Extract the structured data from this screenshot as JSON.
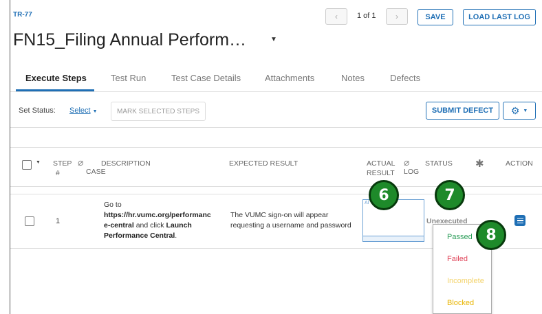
{
  "header": {
    "test_id": "TR-77",
    "title": "FN15_Filing Annual Perform…",
    "pager": {
      "prev": "‹",
      "text": "1 of 1",
      "next": "›"
    },
    "save_label": "SAVE",
    "load_last_log_label": "LOAD LAST LOG"
  },
  "tabs": [
    {
      "label": "Execute Steps"
    },
    {
      "label": "Test Run"
    },
    {
      "label": "Test Case Details"
    },
    {
      "label": "Attachments"
    },
    {
      "label": "Notes"
    },
    {
      "label": "Defects"
    }
  ],
  "status_bar": {
    "set_status_label": "Set Status:",
    "select_label": "Select",
    "mark_selected_label": "MARK SELECTED STEPS",
    "submit_defect_label": "SUBMIT DEFECT"
  },
  "table": {
    "headers": {
      "step": "STEP",
      "step_hash": "#",
      "case": "CASE",
      "description": "DESCRIPTION",
      "expected": "EXPECTED RESULT",
      "actual": "ACTUAL",
      "result": "RESULT",
      "log": "LOG",
      "status": "STATUS",
      "action": "ACTION"
    },
    "rows": [
      {
        "step": "1",
        "desc_line1": "Go to",
        "desc_url1": "https://hr.vumc.org/performanc",
        "desc_url2": "e-central",
        "desc_mid": " and click ",
        "desc_bold": "Launch",
        "desc_bold2": "Performance Central",
        "desc_end": ".",
        "expected_line1": "The VUMC sign-on will appear",
        "expected_line2": "requesting a username and password",
        "thumb_label": "Al",
        "status": "Unexecuted"
      }
    ]
  },
  "status_dropdown": {
    "options": [
      {
        "label": "Passed",
        "color": "#2e9e5b"
      },
      {
        "label": "Failed",
        "color": "#e0455a"
      },
      {
        "label": "Incomplete",
        "color": "#f3d36b"
      },
      {
        "label": "Blocked",
        "color": "#e8b400"
      }
    ]
  },
  "callouts": {
    "c6": "6",
    "c7": "7",
    "c8": "8"
  },
  "colors": {
    "accent": "#1f6fb5",
    "callout": "#1e8a2a"
  }
}
